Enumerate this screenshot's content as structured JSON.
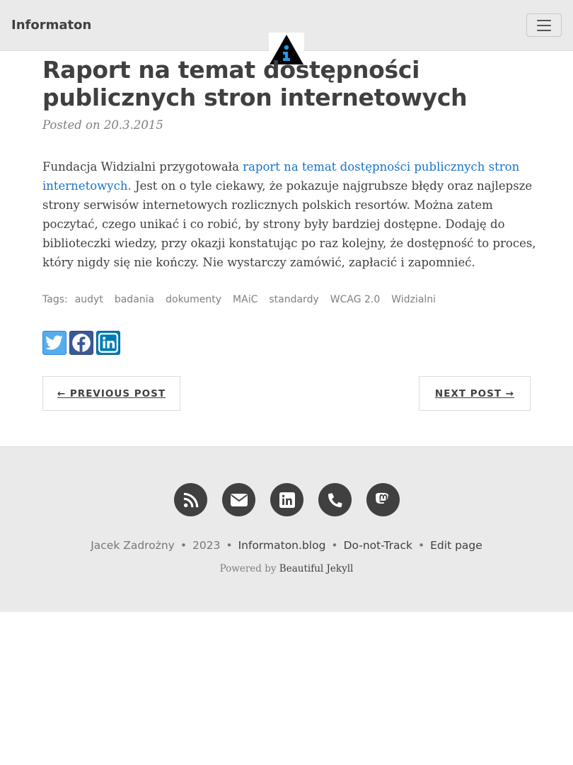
{
  "navbar": {
    "brand": "Informaton",
    "toggle_icon": "hamburger-icon",
    "logo_icon": "informaton-logo-icon"
  },
  "post": {
    "title": "Raport na temat dostępności publicznych stron internetowych",
    "meta": "Posted on 20.3.2015",
    "body_intro": "Fundacja Widzialni przygotowała ",
    "body_link": "raport na temat dostępności publicznych stron internetowych.",
    "body_rest": " Jest on o tyle ciekawy, że pokazuje najgrubsze błędy oraz najlepsze strony serwisów internetowych rozlicznych polskich resortów. Można zatem poczytać, czego unikać i co robić, by strony były bardziej dostępne. Dodaję do biblioteczki wiedzy, przy okazji konstatując po raz kolejny, że dostępność to proces, który nigdy się nie kończy. Nie wystarczy zamówić, zapłacić i zapomnieć.",
    "tags_label": "Tags:",
    "tags": [
      "audyt",
      "badania",
      "dokumenty",
      "MAiC",
      "standardy",
      "WCAG 2.0",
      "Widzialni"
    ]
  },
  "share": {
    "icons": [
      "twitter-icon",
      "facebook-icon",
      "linkedin-icon"
    ],
    "colors": {
      "twitter": "#55acee",
      "facebook": "#3b5998",
      "linkedin": "#007bb5"
    }
  },
  "pager": {
    "previous": "← PREVIOUS POST",
    "next": "NEXT POST →"
  },
  "footer": {
    "social_icons": [
      "rss-icon",
      "envelope-icon",
      "linkedin-icon",
      "phone-icon",
      "mastodon-icon"
    ],
    "author": "Jacek Zadrożny",
    "sep": "•",
    "year": "2023",
    "site": "Informaton.blog",
    "dnt": "Do-not-Track",
    "edit": "Edit page",
    "powered_prefix": "Powered by ",
    "powered_link": "Beautiful Jekyll"
  }
}
